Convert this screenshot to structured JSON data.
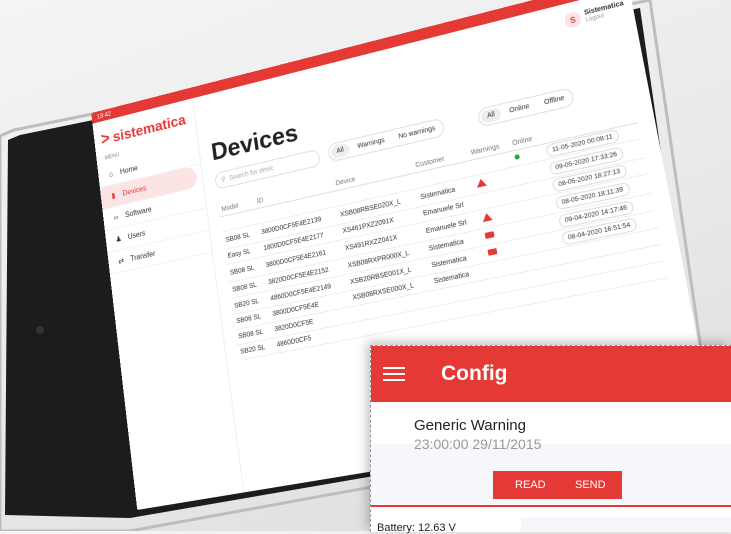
{
  "status": {
    "time": "13:42",
    "icons": "◧ ▮"
  },
  "app": {
    "logo_text": "sistematica",
    "menu_label": "MENU"
  },
  "nav": [
    {
      "label": "Home",
      "icon": "home-icon"
    },
    {
      "label": "Devices",
      "icon": "device-icon"
    },
    {
      "label": "Software",
      "icon": "code-icon"
    },
    {
      "label": "Users",
      "icon": "users-icon"
    },
    {
      "label": "Transfer",
      "icon": "transfer-icon"
    }
  ],
  "user": {
    "initial": "S",
    "name": "Sistematica",
    "logout": "Logout"
  },
  "page": {
    "title": "Devices",
    "search_placeholder": "Search for devic"
  },
  "filters": {
    "warnings": [
      "All",
      "Warnings",
      "No warnings"
    ],
    "online": [
      "All",
      "Online",
      "Offline"
    ]
  },
  "table": {
    "headers": [
      "Model",
      "ID",
      "Device",
      "Customer",
      "Warnings",
      "Online"
    ],
    "rows": [
      {
        "model": "",
        "id": "",
        "device": "",
        "customer": "",
        "warn": "",
        "online": "online",
        "date": "11-05-2020 00:08:11"
      },
      {
        "model": "SB08 SL",
        "id": "3800D0CF5E4E2139",
        "device": "XSB08RBSE020X_L",
        "customer": "Sistematica",
        "warn": "triangle",
        "online": "",
        "date": "09-05-2020 17:33:26"
      },
      {
        "model": "Easy SL",
        "id": "1800D0CF5E4E2177",
        "device": "XS461PXZ2091X",
        "customer": "Emanuele Srl",
        "warn": "",
        "online": "",
        "date": "08-05-2020 18:27:13"
      },
      {
        "model": "SB08 SL",
        "id": "3800D0CF5E4E2161",
        "device": "XS491RXZZ041X",
        "customer": "Emanuele Srl",
        "warn": "triangle",
        "online": "",
        "date": "08-05-2020 18:11:39"
      },
      {
        "model": "SB08 SL",
        "id": "3820D0CF5E4E2152",
        "device": "XSB08RXPR000X_L",
        "customer": "Sistematica",
        "warn": "envelope",
        "online": "",
        "date": "09-04-2020 14:17:46"
      },
      {
        "model": "SB20 SL",
        "id": "4860D0CF5E4E2149",
        "device": "XSB20RBSE001X_L",
        "customer": "Sistematica",
        "warn": "envelope",
        "online": "",
        "date": "08-04-2020 16:51:54"
      },
      {
        "model": "SB08 SL",
        "id": "3800D0CF5E4E",
        "device": "XSB08RXSE000X_L",
        "customer": "Sistematica",
        "warn": "",
        "online": "",
        "date": ""
      },
      {
        "model": "SB08 SL",
        "id": "3820D0CF5E",
        "device": "",
        "customer": "",
        "warn": "",
        "online": "",
        "date": ""
      },
      {
        "model": "SB20 SL",
        "id": "4860D0CF5",
        "device": "",
        "customer": "",
        "warn": "",
        "online": "",
        "date": ""
      }
    ]
  },
  "config": {
    "title": "Config",
    "warning_title": "Generic Warning",
    "warning_time": "23:00:00 29/11/2015",
    "read_label": "READ",
    "send_label": "SEND",
    "battery": "Battery: 12.63 V"
  },
  "colors": {
    "accent": "#e53935",
    "online": "#2e9e3c"
  }
}
